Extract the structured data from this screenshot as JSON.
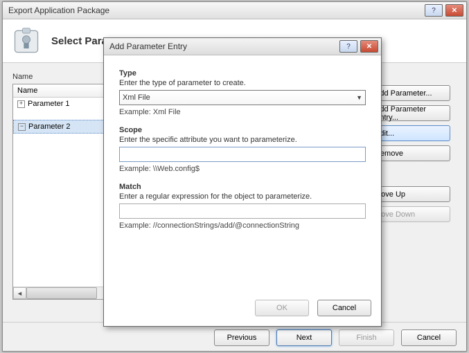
{
  "main": {
    "title": "Export Application Package",
    "banner_title": "Select Parameters",
    "name_label": "Name",
    "parameters": [
      {
        "label": "Parameter 1",
        "selected": false
      },
      {
        "label": "Parameter 2",
        "selected": true
      }
    ],
    "side_buttons": {
      "add_parameter": "Add Parameter...",
      "add_parameter_entry": "Add Parameter Entry...",
      "edit": "Edit...",
      "remove": "Remove",
      "move_up": "Move Up",
      "move_down": "Move Down"
    },
    "wizard_buttons": {
      "previous": "Previous",
      "next": "Next",
      "finish": "Finish",
      "cancel": "Cancel"
    }
  },
  "modal": {
    "title": "Add Parameter Entry",
    "type": {
      "title": "Type",
      "desc": "Enter the type of parameter to create.",
      "value": "Xml File",
      "example": "Example: Xml File"
    },
    "scope": {
      "title": "Scope",
      "desc": "Enter the specific attribute you want to parameterize.",
      "value": "",
      "example": "Example: \\\\Web.config$"
    },
    "match": {
      "title": "Match",
      "desc": "Enter a regular expression for the object to parameterize.",
      "value": "",
      "example": "Example: //connectionStrings/add/@connectionString"
    },
    "buttons": {
      "ok": "OK",
      "cancel": "Cancel"
    }
  }
}
